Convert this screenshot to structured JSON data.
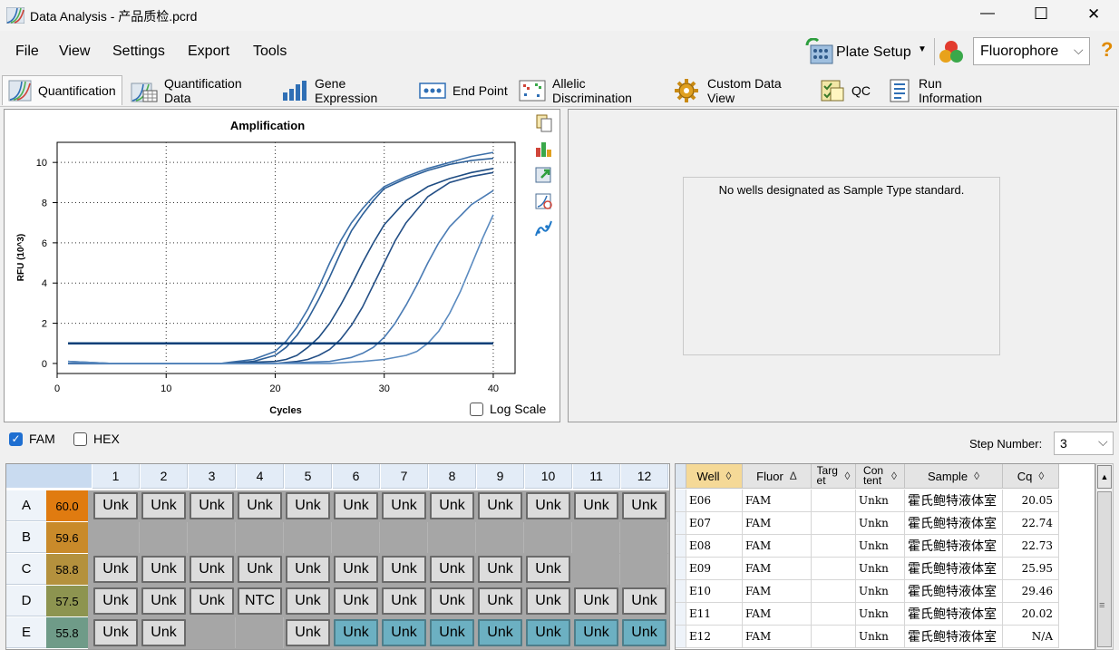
{
  "window": {
    "title": "Data Analysis - 产品质检.pcrd",
    "minimize": "—",
    "maximize": "☐",
    "close": "✕"
  },
  "menu": {
    "items": [
      "File",
      "View",
      "Settings",
      "Export",
      "Tools"
    ],
    "plate_setup": "Plate Setup",
    "fluorophore_select": "Fluorophore",
    "help": "?"
  },
  "tabs": [
    "Quantification",
    "Quantification Data",
    "Gene Expression",
    "End Point",
    "Allelic Discrimination",
    "Custom Data View",
    "QC",
    "Run Information"
  ],
  "chart": {
    "log_scale_label": "Log Scale"
  },
  "chart_data": {
    "type": "line",
    "title": "Amplification",
    "xlabel": "Cycles",
    "ylabel": "RFU (10^3)",
    "xlim": [
      0,
      42
    ],
    "ylim": [
      -0.5,
      11
    ],
    "xticks": [
      0,
      10,
      20,
      30,
      40
    ],
    "yticks": [
      0,
      2,
      4,
      6,
      8,
      10
    ],
    "grid": true,
    "threshold": 1.0,
    "series": [
      {
        "x": [
          1,
          5,
          10,
          15,
          18,
          20,
          21,
          22,
          23,
          24,
          25,
          26,
          27,
          28,
          29,
          30,
          32,
          34,
          36,
          38,
          40
        ],
        "y": [
          0.0,
          0.0,
          0.0,
          0.0,
          0.2,
          0.6,
          1.1,
          1.8,
          2.7,
          3.8,
          5.0,
          6.1,
          7.0,
          7.7,
          8.3,
          8.8,
          9.3,
          9.7,
          10.0,
          10.3,
          10.5
        ]
      },
      {
        "x": [
          1,
          5,
          10,
          15,
          18,
          20,
          21,
          22,
          23,
          24,
          25,
          26,
          27,
          28,
          29,
          30,
          32,
          34,
          36,
          38,
          40
        ],
        "y": [
          0.0,
          0.0,
          0.0,
          0.0,
          0.1,
          0.4,
          0.8,
          1.4,
          2.2,
          3.2,
          4.3,
          5.5,
          6.6,
          7.4,
          8.1,
          8.7,
          9.2,
          9.6,
          9.9,
          10.1,
          10.2
        ]
      },
      {
        "x": [
          1,
          5,
          10,
          15,
          20,
          21,
          22,
          23,
          24,
          25,
          26,
          27,
          28,
          29,
          30,
          32,
          34,
          36,
          38,
          40
        ],
        "y": [
          0.1,
          0.0,
          0.0,
          0.0,
          0.1,
          0.2,
          0.4,
          0.8,
          1.3,
          2.0,
          2.9,
          3.9,
          5.0,
          6.0,
          6.9,
          8.1,
          8.8,
          9.2,
          9.5,
          9.7
        ]
      },
      {
        "x": [
          1,
          5,
          10,
          15,
          20,
          22,
          23,
          24,
          25,
          26,
          27,
          28,
          29,
          30,
          31,
          32,
          34,
          36,
          38,
          40
        ],
        "y": [
          0.0,
          0.0,
          0.0,
          0.0,
          0.0,
          0.1,
          0.2,
          0.4,
          0.7,
          1.2,
          1.9,
          2.8,
          3.9,
          5.0,
          6.1,
          7.0,
          8.3,
          9.0,
          9.3,
          9.5
        ]
      },
      {
        "x": [
          1,
          5,
          10,
          15,
          20,
          25,
          26,
          27,
          28,
          29,
          30,
          31,
          32,
          33,
          34,
          35,
          36,
          38,
          40
        ],
        "y": [
          0.0,
          0.0,
          0.0,
          0.0,
          0.0,
          0.1,
          0.2,
          0.3,
          0.5,
          0.8,
          1.3,
          2.0,
          2.9,
          3.9,
          5.0,
          6.0,
          6.8,
          7.9,
          8.6
        ]
      },
      {
        "x": [
          1,
          5,
          10,
          15,
          20,
          25,
          28,
          30,
          32,
          33,
          34,
          35,
          36,
          37,
          38,
          39,
          40
        ],
        "y": [
          0.1,
          0.0,
          0.0,
          0.0,
          0.0,
          0.0,
          0.1,
          0.2,
          0.4,
          0.6,
          1.0,
          1.6,
          2.5,
          3.6,
          4.9,
          6.2,
          7.4
        ]
      }
    ]
  },
  "standard_panel": {
    "message": "No wells designated as Sample Type standard."
  },
  "fluor_filter": {
    "fam": "FAM",
    "hex": "HEX",
    "step_label": "Step Number:",
    "step_value": "3"
  },
  "plate": {
    "columns": [
      "1",
      "2",
      "3",
      "4",
      "5",
      "6",
      "7",
      "8",
      "9",
      "10",
      "11",
      "12"
    ],
    "rows": [
      {
        "label": "A",
        "temp": "60.0",
        "wells": [
          "Unk",
          "Unk",
          "Unk",
          "Unk",
          "Unk",
          "Unk",
          "Unk",
          "Unk",
          "Unk",
          "Unk",
          "Unk",
          "Unk"
        ]
      },
      {
        "label": "B",
        "temp": "59.6",
        "wells": [
          "",
          "",
          "",
          "",
          "",
          "",
          "",
          "",
          "",
          "",
          "",
          ""
        ]
      },
      {
        "label": "C",
        "temp": "58.8",
        "wells": [
          "Unk",
          "Unk",
          "Unk",
          "Unk",
          "Unk",
          "Unk",
          "Unk",
          "Unk",
          "Unk",
          "Unk",
          "",
          ""
        ]
      },
      {
        "label": "D",
        "temp": "57.5",
        "wells": [
          "Unk",
          "Unk",
          "Unk",
          "NTC",
          "Unk",
          "Unk",
          "Unk",
          "Unk",
          "Unk",
          "Unk",
          "Unk",
          "Unk"
        ]
      },
      {
        "label": "E",
        "temp": "55.8",
        "wells": [
          "Unk",
          "Unk",
          "",
          "",
          "Unk",
          "Unk",
          "Unk",
          "Unk",
          "Unk",
          "Unk",
          "Unk",
          "Unk"
        ]
      }
    ],
    "selected_wells_row_E": [
      5,
      6,
      7,
      8,
      9,
      10,
      11
    ],
    "temp_colors": [
      "#e07b10",
      "#c98a2a",
      "#b4913d",
      "#8d9450",
      "#6f9b88",
      "#6a98a4"
    ]
  },
  "well_table": {
    "headers": [
      "Well",
      "Fluor",
      "Target",
      "Content",
      "Sample",
      "Cq"
    ],
    "rows": [
      [
        "E06",
        "FAM",
        "",
        "Unkn",
        "霍氏鲍特液体室",
        "20.05"
      ],
      [
        "E07",
        "FAM",
        "",
        "Unkn",
        "霍氏鲍特液体室",
        "22.74"
      ],
      [
        "E08",
        "FAM",
        "",
        "Unkn",
        "霍氏鲍特液体室",
        "22.73"
      ],
      [
        "E09",
        "FAM",
        "",
        "Unkn",
        "霍氏鲍特液体室",
        "25.95"
      ],
      [
        "E10",
        "FAM",
        "",
        "Unkn",
        "霍氏鲍特液体室",
        "29.46"
      ],
      [
        "E11",
        "FAM",
        "",
        "Unkn",
        "霍氏鲍特液体室",
        "20.02"
      ],
      [
        "E12",
        "FAM",
        "",
        "Unkn",
        "霍氏鲍特液体室",
        "N/A"
      ]
    ]
  }
}
